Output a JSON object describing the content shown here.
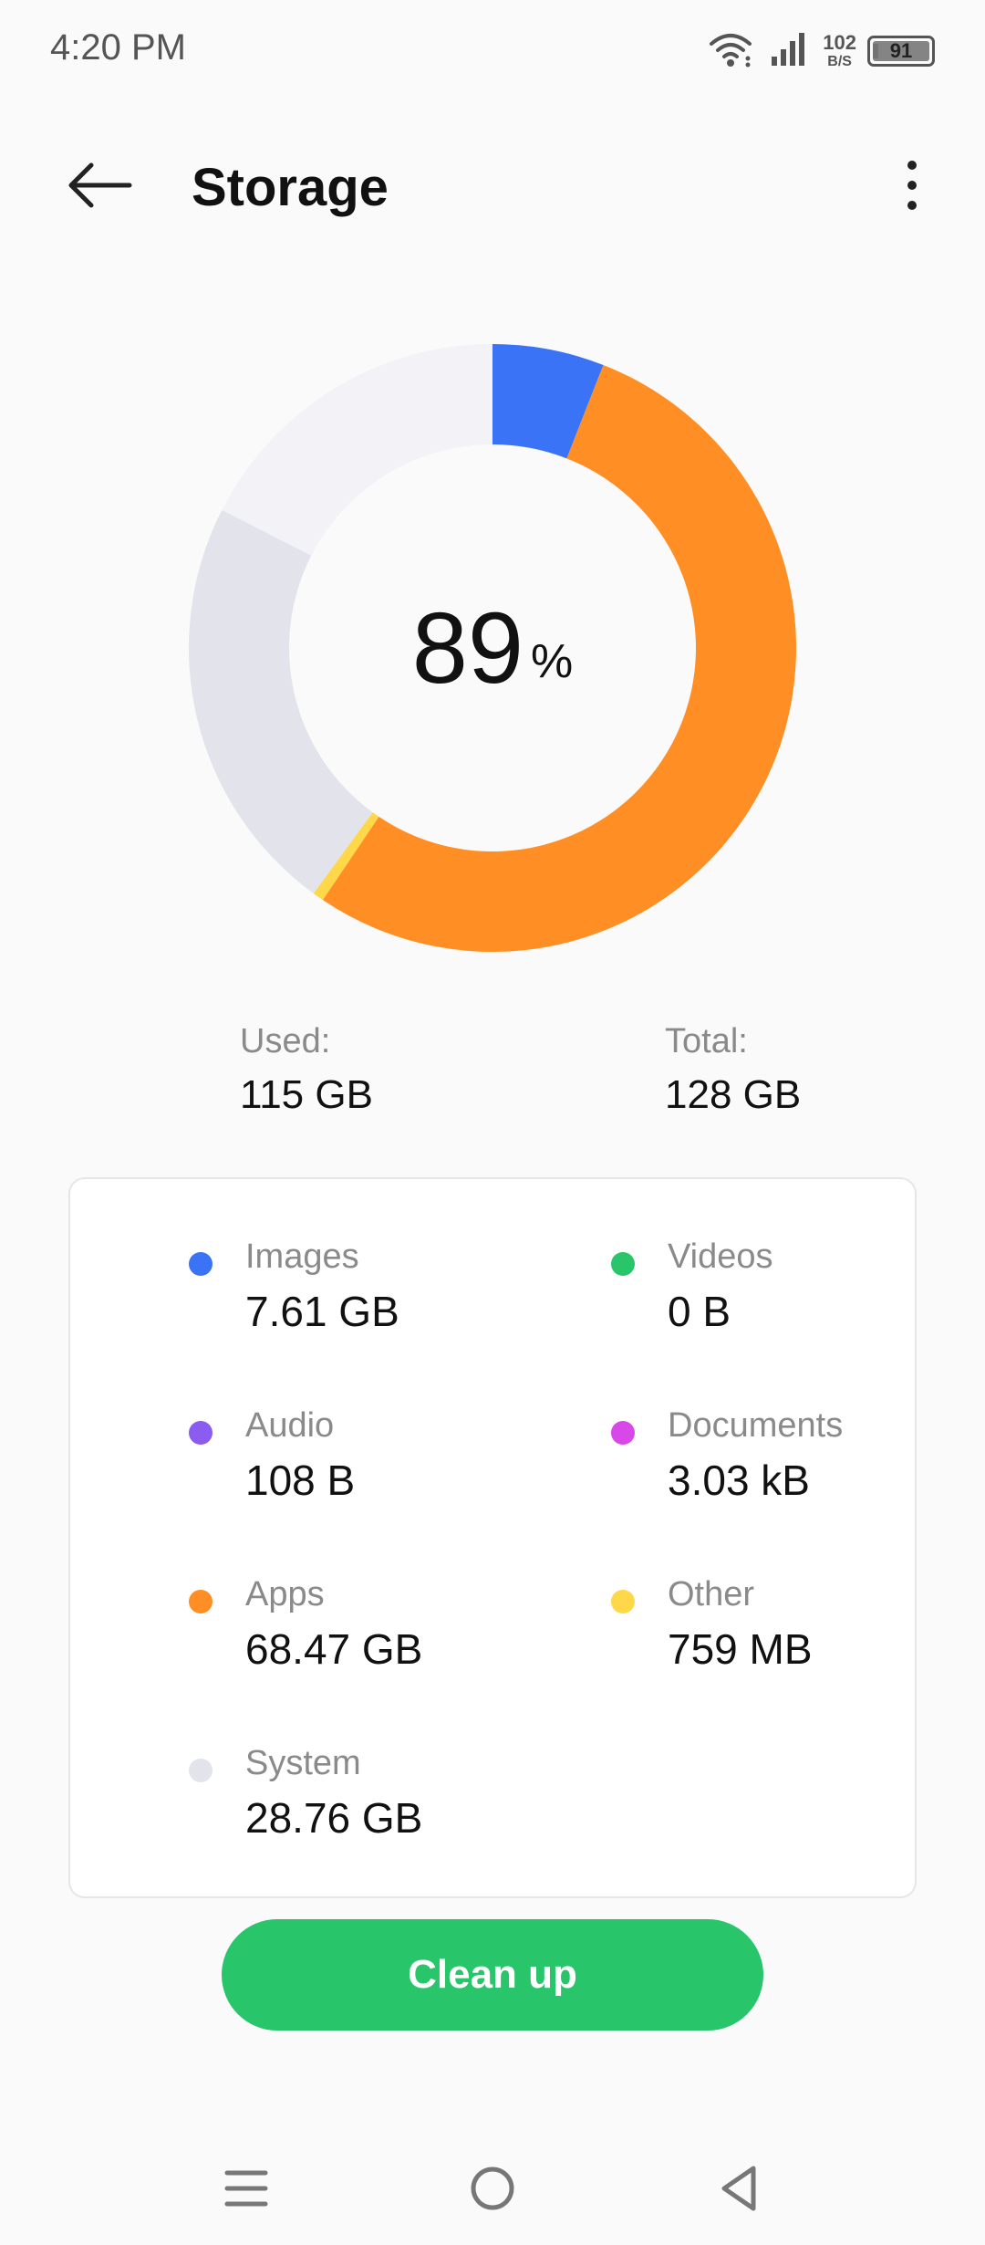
{
  "status_bar": {
    "time": "4:20 PM",
    "net_speed_value": "102",
    "net_speed_unit": "B/S",
    "battery_level": "91",
    "icons": [
      "wifi-icon",
      "signal-icon",
      "battery-icon"
    ]
  },
  "app_bar": {
    "title": "Storage",
    "back_icon": "arrow-left-icon",
    "more_icon": "more-vertical-icon"
  },
  "usage": {
    "percent": "89",
    "percent_sign": "%",
    "used_label": "Used:",
    "used_value": "115 GB",
    "total_label": "Total:",
    "total_value": "128 GB"
  },
  "categories": [
    {
      "label": "Images",
      "value": "7.61 GB",
      "color": "#3a73f5"
    },
    {
      "label": "Videos",
      "value": "0 B",
      "color": "#29c56b"
    },
    {
      "label": "Audio",
      "value": "108 B",
      "color": "#8b5cf0"
    },
    {
      "label": "Documents",
      "value": "3.03 kB",
      "color": "#d848e8"
    },
    {
      "label": "Apps",
      "value": "68.47 GB",
      "color": "#ff8f24"
    },
    {
      "label": "Other",
      "value": "759 MB",
      "color": "#ffd84a"
    },
    {
      "label": "System",
      "value": "28.76 GB",
      "color": "#e3e3ec"
    }
  ],
  "donut": {
    "free_color": "#f2f2f7",
    "segments_gb": [
      {
        "name": "Images",
        "gb": 7.61,
        "color": "#3a73f5"
      },
      {
        "name": "Apps",
        "gb": 68.47,
        "color": "#ff8f24"
      },
      {
        "name": "Other",
        "gb": 0.759,
        "color": "#ffd84a"
      },
      {
        "name": "System",
        "gb": 28.76,
        "color": "#e3e3ec"
      }
    ],
    "total_gb": 128
  },
  "cleanup_label": "Clean up",
  "nav": {
    "menu_icon": "menu-icon",
    "home_icon": "home-circle-icon",
    "back_icon": "back-triangle-icon"
  }
}
